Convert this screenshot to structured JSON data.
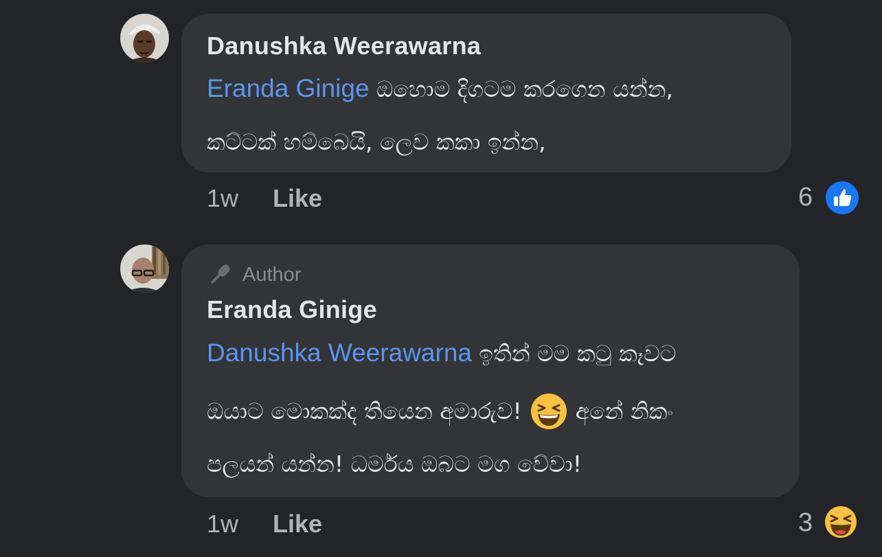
{
  "comments": [
    {
      "author": "Danushka Weerawarna",
      "mention": "Eranda Ginige",
      "line1_text": "ඔහොම දිගටම කරගෙන යන්න,",
      "line2_text": "කට්ටක් හම්බෙයි, ලෙව කකා ඉන්න,",
      "time": "1w",
      "like_label": "Like",
      "reaction_count": "6",
      "reaction_icon": "thumbs-up-icon",
      "avatar_icon": "user-avatar-danushka"
    },
    {
      "badge": "Author",
      "badge_icon": "microphone-icon",
      "author": "Eranda Ginige",
      "mention": "Danushka Weerawarna",
      "line1_text": "ඉතින් මම කටු කෑවට",
      "line2_text": "ඔයාට මොකක්ද තියෙන අමාරුව!",
      "line2_emoji": "😆",
      "line2_after": "අනේ නිකං",
      "line3_text": "පලයන් යන්න! ධර්මය ඔබට මග වේවා!",
      "time": "1w",
      "like_label": "Like",
      "reaction_count": "3",
      "reaction_icon": "haha-icon",
      "avatar_icon": "user-avatar-eranda"
    }
  ],
  "colors": {
    "background": "#232427",
    "bubble": "#333437",
    "mention": "#5a95ee",
    "like_blue": "#1877f2"
  }
}
